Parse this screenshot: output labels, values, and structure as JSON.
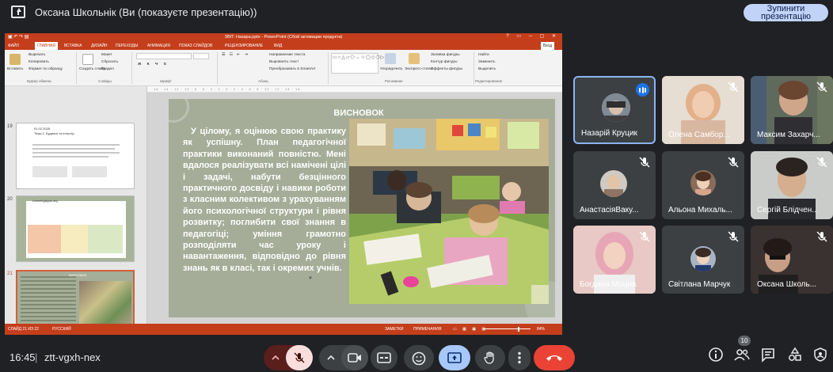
{
  "top_bar": {
    "presentation_title": "Оксана Школьнік (Ви (показуєте презентацію))",
    "stop_button_label": "Зупинити презентацію"
  },
  "powerpoint": {
    "window_title": "ЗВІТ. Назара.pptx - PowerPoint (Сбой активации продукта)",
    "tabs": [
      "ФАЙЛ",
      "ГЛАВНАЯ",
      "ВСТАВКА",
      "ДИЗАЙН",
      "ПЕРЕХОДЫ",
      "АНИМАЦИЯ",
      "ПОКАЗ СЛАЙДОВ",
      "РЕЦЕНЗИРОВАНИЕ",
      "ВИД"
    ],
    "login_label": "Вход",
    "ribbon": {
      "paste": "Вставить",
      "cut": "Вырезать",
      "copy": "Копировать",
      "format_painter": "Формат по образцу",
      "new_slide": "Создать слайд",
      "layout": "Макет",
      "reset": "Сбросить",
      "section": "Раздел",
      "text_direction": "Направление текста",
      "align_text": "Выровнять текст",
      "smartart": "Преобразовать в SmartArt",
      "arrange": "Упорядочить",
      "quick_styles": "Экспресс-стили",
      "shape_fill": "Заливка фигуры",
      "shape_outline": "Контур фигуры",
      "shape_effects": "Эффекты фигуры",
      "find": "Найти",
      "replace": "Заменить",
      "select": "Выделить",
      "groups": {
        "clipboard": "Буфер обмена",
        "slides": "Слайды",
        "font": "Шрифт",
        "paragraph": "Абзац",
        "drawing": "Рисование",
        "editing": "Редактирование"
      }
    },
    "thumbnails": [
      {
        "number": "19",
        "date": "01.02.2025.",
        "title": "Тема 2. Будинок та інтер'єр"
      },
      {
        "number": "20",
        "label": "LearningApps.org"
      },
      {
        "number": "21",
        "label": "ВИСНОВОК"
      }
    ],
    "status_bar": {
      "slide_info": "СЛАЙД 21 ИЗ 22",
      "language": "РУССКИЙ",
      "notes": "ЗАМЕТКИ",
      "comments": "ПРИМЕЧАНИЯ",
      "zoom": "84%"
    },
    "slide": {
      "title": "ВИСНОВОК",
      "body": "У цілому, я оцінюю свою практику як успішну. План педагогічної практики виконаний повністю. Мені вдалося реалізувати всі намічені цілі і задачі, набути безцінного практичного досвіду і навики роботи з класним колективом з урахуванням його психологічної структури і рівня розвитку; поглибити свої знання в педагогіці; уміння грамотно розподіляти час уроку і навантаження, відповідно до рівня знань як в класі, так і окремих учнів."
    }
  },
  "participants": [
    {
      "name": "Назарій Круцик",
      "muted": false,
      "speaking": true
    },
    {
      "name": "Олена Самбор...",
      "muted": true
    },
    {
      "name": "Максим Захарч...",
      "muted": true
    },
    {
      "name": "АнастасіяВаку...",
      "muted": true
    },
    {
      "name": "Альона Михаль...",
      "muted": true
    },
    {
      "name": "Сергій Блідчен...",
      "muted": true
    },
    {
      "name": "Богдана Моцна",
      "muted": true
    },
    {
      "name": "Світлана Марчук",
      "muted": true
    },
    {
      "name": "Оксана Школь...",
      "muted": true
    }
  ],
  "bottom_bar": {
    "time": "16:45",
    "meeting_code": "ztt-vgxh-nex",
    "participant_count": "10"
  },
  "colors": {
    "meet_bg": "#202124",
    "tile_bg": "#3c4043",
    "leave_red": "#ea4335",
    "present_blue": "#8ab4f8",
    "ppt_accent": "#c43e1c",
    "slide_bg": "#a5ac98"
  }
}
